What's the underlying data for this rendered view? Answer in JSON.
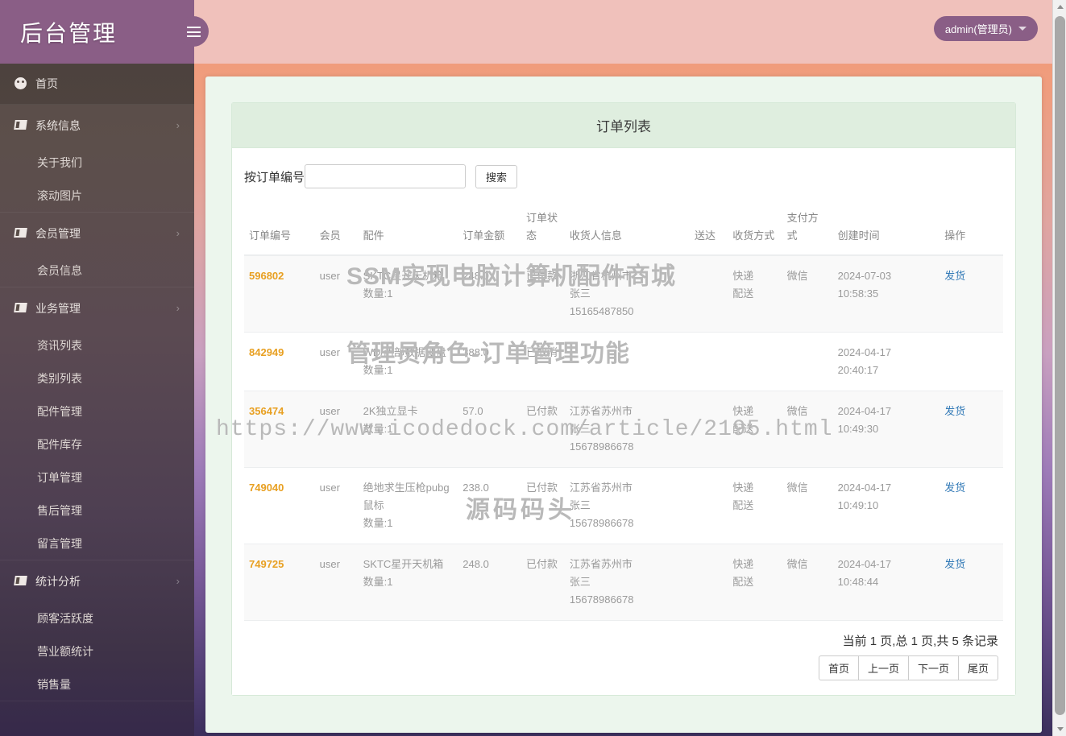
{
  "brand": {
    "title": "后台管理",
    "hamburger_label": "菜单"
  },
  "topbar": {
    "user_label": "admin(管理员)"
  },
  "sidebar": {
    "home": {
      "label": "首页",
      "icon": "dashboard-icon"
    },
    "groups": [
      {
        "label": "系统信息",
        "icon": "book-icon",
        "chevron": "›",
        "items": [
          {
            "label": "关于我们"
          },
          {
            "label": "滚动图片"
          }
        ]
      },
      {
        "label": "会员管理",
        "icon": "book-icon",
        "chevron": "›",
        "items": [
          {
            "label": "会员信息"
          }
        ]
      },
      {
        "label": "业务管理",
        "icon": "book-icon",
        "chevron": "›",
        "items": [
          {
            "label": "资讯列表"
          },
          {
            "label": "类别列表"
          },
          {
            "label": "配件管理"
          },
          {
            "label": "配件库存"
          },
          {
            "label": "订单管理"
          },
          {
            "label": "售后管理"
          },
          {
            "label": "留言管理"
          }
        ]
      },
      {
        "label": "统计分析",
        "icon": "book-icon",
        "chevron": "›",
        "items": [
          {
            "label": "顾客活跃度"
          },
          {
            "label": "营业额统计"
          },
          {
            "label": "销售量"
          }
        ]
      }
    ]
  },
  "panel": {
    "title": "订单列表",
    "search": {
      "label": "按订单编号",
      "value": "",
      "placeholder": "",
      "button": "搜索"
    },
    "table": {
      "headers": [
        "订单编号",
        "会员",
        "配件",
        "订单金额",
        "订单状态",
        "收货人信息",
        "送达",
        "收货方式",
        "支付方式",
        "创建时间",
        "操作"
      ],
      "rows": [
        {
          "order_no": "596802",
          "member": "user",
          "part_name": "SKTC星开天机箱",
          "part_qty": "数量:1",
          "amount": "248.0",
          "status": "已付款",
          "receiver_addr": "浙江省杭州市",
          "receiver_name": "张三",
          "receiver_phone": "15165487850",
          "arrive": "",
          "ship_method": "快递配送",
          "pay_method": "微信",
          "created_date": "2024-07-03",
          "created_time": "10:58:35",
          "action": "发货"
        },
        {
          "order_no": "842949",
          "member": "user",
          "part_name": "WD/西部数据硬盘",
          "part_qty": "数量:1",
          "amount": "388.0",
          "status": "已取消",
          "receiver_addr": "",
          "receiver_name": "",
          "receiver_phone": "",
          "arrive": "",
          "ship_method": "",
          "pay_method": "",
          "created_date": "2024-04-17",
          "created_time": "20:40:17",
          "action": ""
        },
        {
          "order_no": "356474",
          "member": "user",
          "part_name": "2K独立显卡",
          "part_qty": "数量:1",
          "amount": "57.0",
          "status": "已付款",
          "receiver_addr": "江苏省苏州市",
          "receiver_name": "张三",
          "receiver_phone": "15678986678",
          "arrive": "",
          "ship_method": "快递配送",
          "pay_method": "微信",
          "created_date": "2024-04-17",
          "created_time": "10:49:30",
          "action": "发货"
        },
        {
          "order_no": "749040",
          "member": "user",
          "part_name": "绝地求生压枪pubg鼠标",
          "part_qty": "数量:1",
          "amount": "238.0",
          "status": "已付款",
          "receiver_addr": "江苏省苏州市",
          "receiver_name": "张三",
          "receiver_phone": "15678986678",
          "arrive": "",
          "ship_method": "快递配送",
          "pay_method": "微信",
          "created_date": "2024-04-17",
          "created_time": "10:49:10",
          "action": "发货"
        },
        {
          "order_no": "749725",
          "member": "user",
          "part_name": "SKTC星开天机箱",
          "part_qty": "数量:1",
          "amount": "248.0",
          "status": "已付款",
          "receiver_addr": "江苏省苏州市",
          "receiver_name": "张三",
          "receiver_phone": "15678986678",
          "arrive": "",
          "ship_method": "快递配送",
          "pay_method": "微信",
          "created_date": "2024-04-17",
          "created_time": "10:48:44",
          "action": "发货"
        }
      ]
    },
    "pager": {
      "info": "当前 1 页,总 1 页,共 5 条记录",
      "first": "首页",
      "prev": "上一页",
      "next": "下一页",
      "last": "尾页"
    }
  },
  "watermarks": {
    "line1": "SSM实现电脑计算机配件商城",
    "line2": "管理员角色-订单管理功能",
    "line3": "https://www.icodedock.com/article/2195.html",
    "line4": "源码码头"
  },
  "colors": {
    "brand_purple": "#8a5e86",
    "topbar_pink": "#f0c1bb",
    "panel_green": "#dfeedf",
    "content_bg": "#ecf6ed",
    "order_no_orange": "#e8a022",
    "link_blue": "#337ab7"
  }
}
